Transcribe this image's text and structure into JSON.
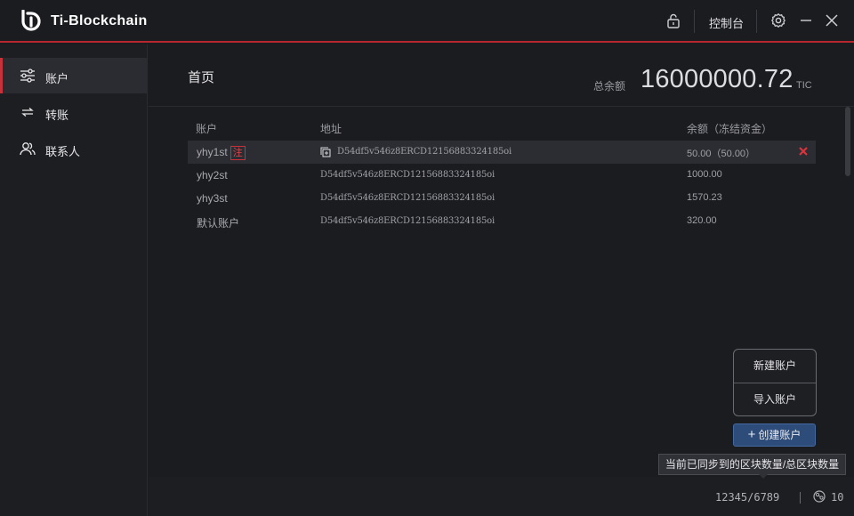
{
  "app": {
    "title": "Ti-Blockchain"
  },
  "titlebar": {
    "console_label": "控制台",
    "icons": [
      "lock-icon",
      "gear-icon",
      "minimize-icon",
      "close-icon"
    ]
  },
  "sidebar": {
    "items": [
      {
        "label": "账户",
        "icon": "sliders-icon",
        "active": true
      },
      {
        "label": "转账",
        "icon": "transfer-arrows-icon",
        "active": false
      },
      {
        "label": "联系人",
        "icon": "contacts-icon",
        "active": false
      }
    ]
  },
  "main": {
    "page_title": "首页",
    "balance_label": "总余额",
    "balance_value": "16000000.72",
    "balance_unit": "TIC"
  },
  "table": {
    "headers": {
      "account": "账户",
      "address": "地址",
      "balance": "余额（冻结资金）"
    },
    "rows": [
      {
        "account": "yhy1st",
        "badge": "注",
        "address": "D54df5v546z8ERCD12156883324185oi",
        "balance": "50.00（50.00）",
        "selected": true
      },
      {
        "account": "yhy2st",
        "address": "D54df5v546z8ERCD12156883324185oi",
        "balance": "1000.00"
      },
      {
        "account": "yhy3st",
        "address": "D54df5v546z8ERCD12156883324185oi",
        "balance": "1570.23"
      },
      {
        "account": "默认账户",
        "address": "D54df5v546z8ERCD12156883324185oi",
        "balance": "320.00"
      }
    ]
  },
  "popup_menu": {
    "items": [
      "新建账户",
      "导入账户"
    ]
  },
  "create_button": {
    "label": "创建账户"
  },
  "statusbar": {
    "tooltip": "当前已同步到的区块数量/总区块数量",
    "sync": "12345/6789",
    "peers": "10"
  },
  "colors": {
    "accent_red": "#c8313a",
    "button_blue": "#2e4c7a",
    "background": "#1b1c20"
  }
}
